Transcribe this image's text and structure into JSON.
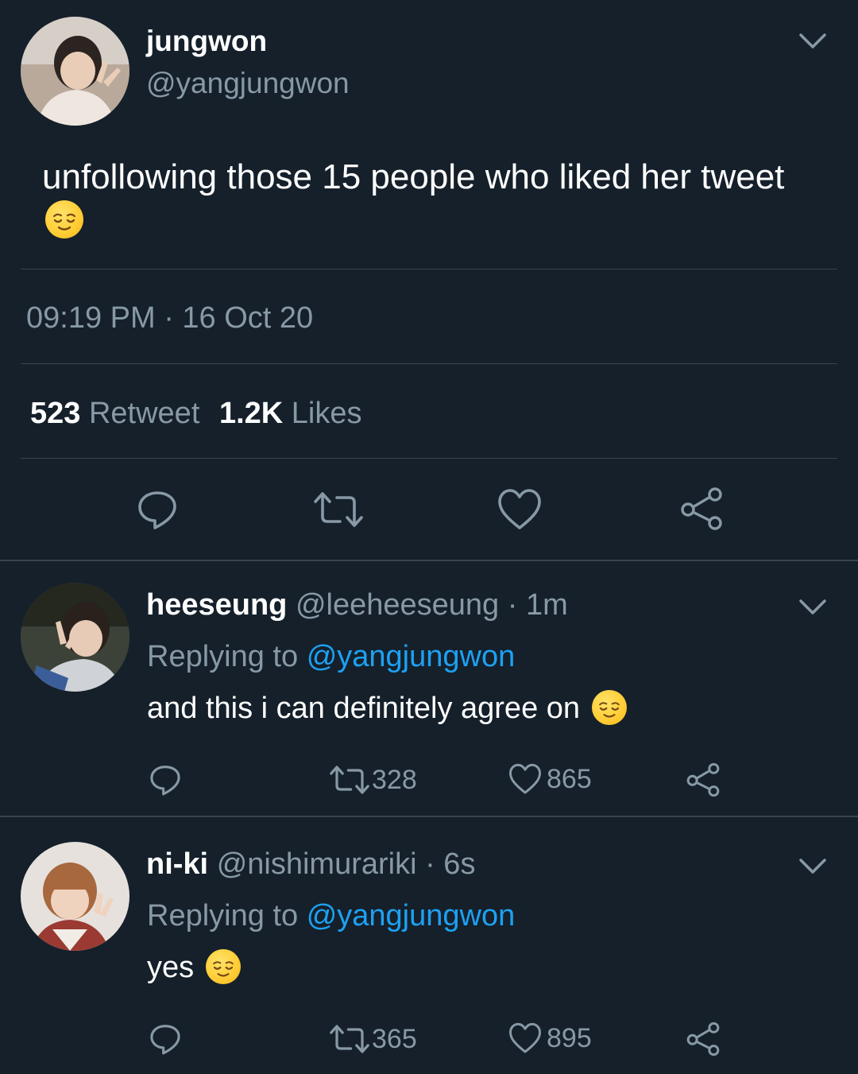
{
  "main_tweet": {
    "display_name": "jungwon",
    "handle": "@yangjungwon",
    "text": "unfollowing those 15 people who liked her tweet",
    "emoji": "relieved-face",
    "timestamp": "09:19 PM · 16 Oct 20",
    "retweet_count": "523",
    "retweet_label": "Retweet",
    "like_count": "1.2K",
    "like_label": "Likes"
  },
  "replies": [
    {
      "display_name": "heeseung",
      "handle": "@leeheeseung",
      "time": "· 1m",
      "replying_to_label": "Replying to",
      "replying_to_handle": "@yangjungwon",
      "text": "and this i can definitely agree on",
      "emoji": "relieved-face",
      "retweets": "328",
      "likes": "865"
    },
    {
      "display_name": "ni-ki",
      "handle": "@nishimurariki",
      "time": "· 6s",
      "replying_to_label": "Replying to",
      "replying_to_handle": "@yangjungwon",
      "text": "yes",
      "emoji": "relieved-face",
      "retweets": "365",
      "likes": "895"
    }
  ],
  "colors": {
    "background": "#15202b",
    "muted": "#8899a6",
    "link": "#1da1f2",
    "divider": "#38444d"
  },
  "icons": [
    "chevron-down-icon",
    "reply-icon",
    "retweet-icon",
    "heart-icon",
    "share-icon",
    "relieved-face-emoji"
  ]
}
